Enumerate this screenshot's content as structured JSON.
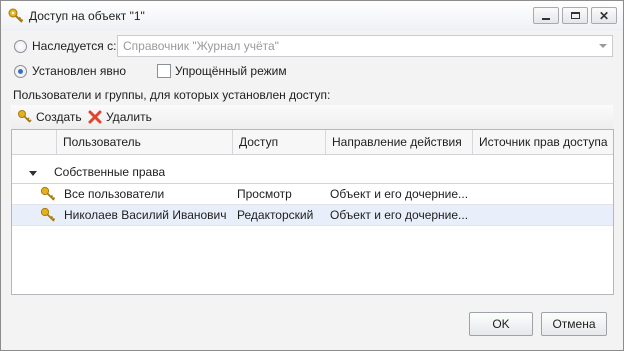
{
  "window": {
    "title": "Доступ на объект \"1\"",
    "controls": {
      "minimize": "",
      "maximize": "",
      "close": "✕"
    }
  },
  "inherit": {
    "label": "Наследуется с:",
    "checked": false,
    "combo_value": "Справочник \"Журнал учёта\""
  },
  "explicit": {
    "label": "Установлен явно",
    "checked": true
  },
  "simplified": {
    "label": "Упрощённый режим",
    "checked": false
  },
  "list_caption": "Пользователи и группы, для которых установлен доступ:",
  "toolbar": {
    "create_label": "Создать",
    "delete_label": "Удалить"
  },
  "grid": {
    "columns": [
      "Пользователь",
      "Доступ",
      "Направление действия",
      "Источник прав доступа"
    ],
    "group_label": "Собственные права",
    "rows": [
      {
        "user": "Все пользователи",
        "access": "Просмотр",
        "direction": "Объект и его дочерние...",
        "source": ""
      },
      {
        "user": "Николаев Василий Иванович",
        "access": "Редакторский",
        "direction": "Объект и его дочерние...",
        "source": ""
      }
    ]
  },
  "buttons": {
    "ok_label": "OK",
    "cancel_label": "Отмена"
  },
  "colors": {
    "key_icon": "#e3b21f",
    "delete_icon": "#e2432f",
    "selected_row": "#e9effa"
  }
}
